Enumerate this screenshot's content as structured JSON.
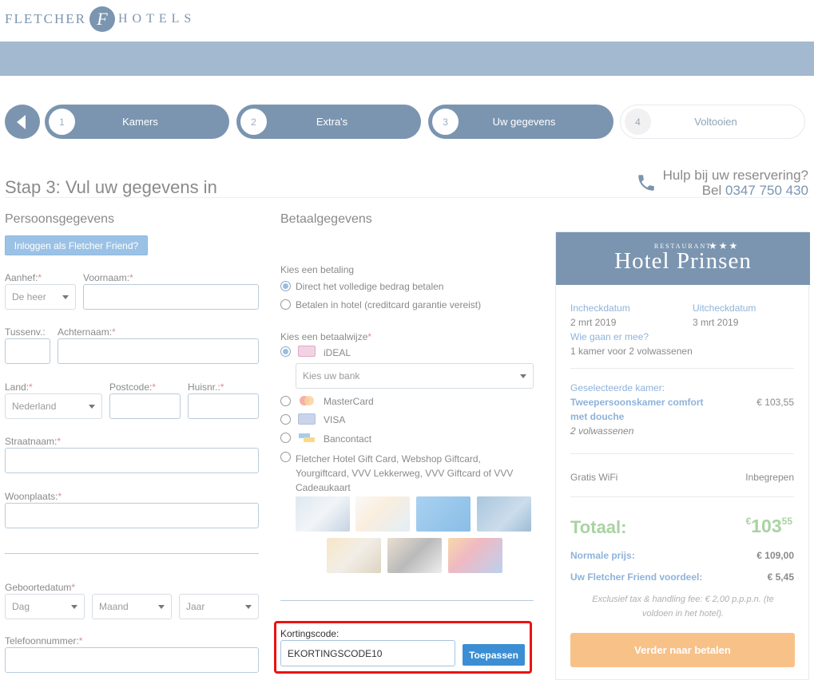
{
  "header": {
    "brand_left": "FLETCHER",
    "brand_mono": "F",
    "brand_right": "HOTELS"
  },
  "steps": [
    {
      "num": "1",
      "label": "Kamers"
    },
    {
      "num": "2",
      "label": "Extra's"
    },
    {
      "num": "3",
      "label": "Uw gegevens"
    },
    {
      "num": "4",
      "label": "Voltooien"
    }
  ],
  "page_title": "Stap 3: Vul uw gegevens in",
  "help": {
    "line1": "Hulp bij uw reservering?",
    "bel": "Bel",
    "phone": "0347 750 430"
  },
  "personal": {
    "title": "Persoonsgegevens",
    "login_button": "Inloggen als Fletcher Friend?",
    "aanhef_label": "Aanhef:",
    "aanhef_value": "De heer",
    "voornaam_label": "Voornaam:",
    "tussenv_label": "Tussenv.:",
    "achternaam_label": "Achternaam:",
    "land_label": "Land:",
    "land_value": "Nederland",
    "postcode_label": "Postcode:",
    "huisnr_label": "Huisnr.:",
    "straatnaam_label": "Straatnaam:",
    "woonplaats_label": "Woonplaats:",
    "geboortedatum_label": "Geboortedatum",
    "dag": "Dag",
    "maand": "Maand",
    "jaar": "Jaar",
    "telefoon_label": "Telefoonnummer:",
    "req": "*"
  },
  "payment": {
    "title": "Betaalgegevens",
    "kies_betaling": "Kies een betaling",
    "opt_full": "Direct het volledige bedrag betalen",
    "opt_hotel": "Betalen in hotel (creditcard garantie vereist)",
    "kies_wijze": "Kies een betaalwijze",
    "ideal": "iDEAL",
    "bank_placeholder": "Kies uw bank",
    "mastercard": "MasterCard",
    "visa": "VISA",
    "bancontact": "Bancontact",
    "giftcard": "Fletcher Hotel Gift Card, Webshop Giftcard, Yourgiftcard, VVV Lekkerweg, VVV Giftcard of VVV Cadeaukaart",
    "kortingscode_label": "Kortingscode:",
    "kortingscode_value": "EKORTINGSCODE10",
    "apply_button": "Toepassen"
  },
  "summary": {
    "hotel_rest": "RESTAURANT",
    "hotel_name": "Hotel Prinsen",
    "hotel_stars": "★★★",
    "checkin_label": "Incheckdatum",
    "checkin_value": "2 mrt 2019",
    "checkout_label": "Uitcheckdatum",
    "checkout_value": "3 mrt 2019",
    "who_label": "Wie gaan er mee?",
    "who_value": "1 kamer voor 2 volwassenen",
    "room_label": "Geselecteerde kamer:",
    "room_name_1": "Tweepersoonskamer comfort",
    "room_name_2": "met douche",
    "room_price": "€ 103,55",
    "room_guests": "2 volwassenen",
    "wifi_label": "Gratis WiFi",
    "wifi_value": "Inbegrepen",
    "total_label": "Totaal:",
    "total_currency": "€",
    "total_main": "103",
    "total_cents": "55",
    "normal_label": "Normale prijs:",
    "normal_value": "€ 109,00",
    "ff_label": "Uw Fletcher Friend voordeel:",
    "ff_value": "€ 5,45",
    "tax_note": "Exclusief tax & handling fee: € 2,00 p.p.p.n. (te voldoen in het hotel).",
    "pay_button": "Verder naar betalen"
  }
}
